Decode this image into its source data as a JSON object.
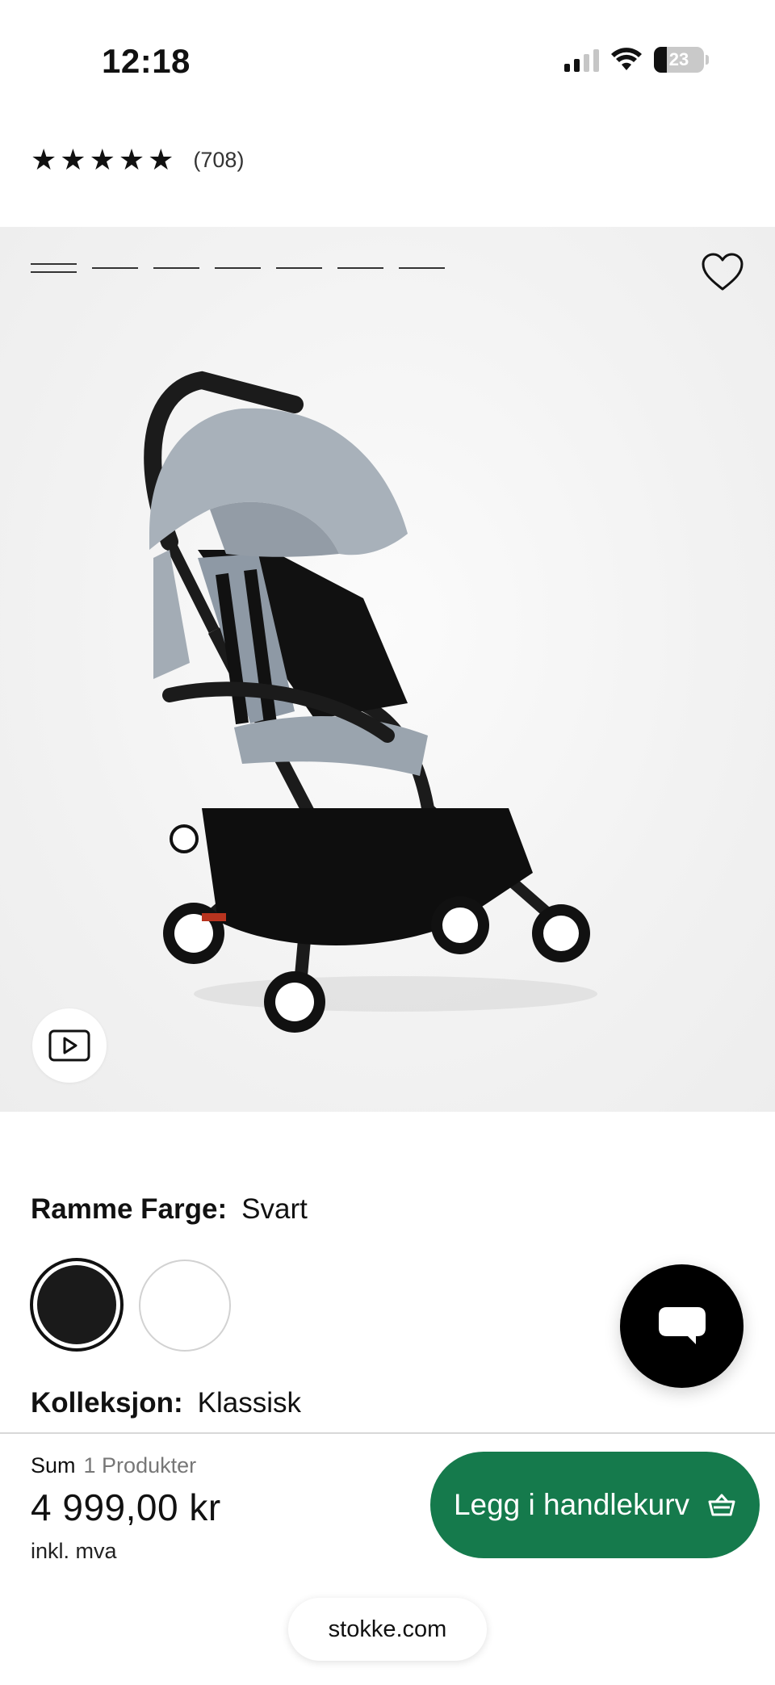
{
  "status_bar": {
    "time": "12:18",
    "battery": "23"
  },
  "rating": {
    "stars": 5,
    "count": "(708)"
  },
  "gallery": {
    "image_count": 7,
    "active_index": 0,
    "product_image": "stroller-image",
    "video_icon": "play-video-icon",
    "favorite_icon": "heart-icon"
  },
  "frame_color": {
    "label": "Ramme Farge:",
    "value": "Svart",
    "swatches": [
      {
        "name": "Svart",
        "color": "#1a1a1a",
        "selected": true
      },
      {
        "name": "Hvit",
        "color": "#ffffff",
        "selected": false
      }
    ]
  },
  "collection": {
    "label": "Kolleksjon:",
    "value": "Klassisk"
  },
  "cart": {
    "sum_label": "Sum",
    "products_label": "1 Produkter",
    "price": "4 999,00 kr",
    "vat_note": "inkl. mva",
    "button_label": "Legg i handlekurv",
    "button_color": "#157a4c"
  },
  "browser": {
    "url": "stokke.com"
  }
}
